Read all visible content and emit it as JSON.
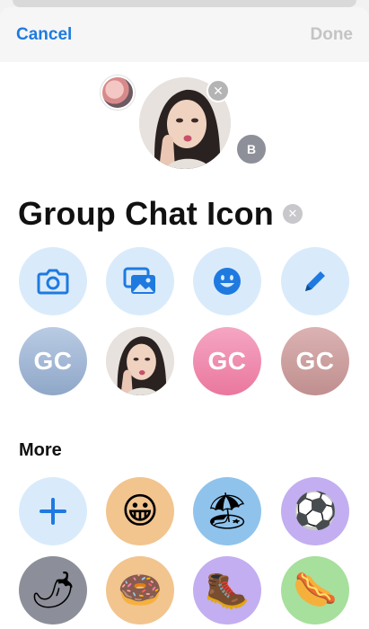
{
  "nav": {
    "cancel_label": "Cancel",
    "done_label": "Done"
  },
  "avatar": {
    "badge_letter": "B"
  },
  "title": "Group Chat Icon",
  "actions": [
    {
      "icon": "camera-icon"
    },
    {
      "icon": "photo-library-icon"
    },
    {
      "icon": "emoji-icon"
    },
    {
      "icon": "pencil-icon"
    }
  ],
  "suggestions": [
    {
      "type": "monogram",
      "text": "GC",
      "color": "#a9bedb"
    },
    {
      "type": "photo"
    },
    {
      "type": "monogram",
      "text": "GC",
      "color": "#ef8fb0"
    },
    {
      "type": "monogram",
      "text": "GC",
      "color": "#cfa3a3"
    }
  ],
  "more": {
    "label": "More",
    "items": [
      {
        "name": "add-icon",
        "glyph": "+",
        "bg": "#d9ebfb"
      },
      {
        "name": "grinning-face-emoji",
        "glyph": "😀",
        "bg": "#f2c48e"
      },
      {
        "name": "beach-umbrella-emoji",
        "glyph": "🏖",
        "bg": "#8fc3ec"
      },
      {
        "name": "soccer-ball-emoji",
        "glyph": "⚽",
        "bg": "#c2aef0"
      },
      {
        "name": "hot-pepper-emoji",
        "glyph": "🌶",
        "bg": "#8c8f99"
      },
      {
        "name": "doughnut-emoji",
        "glyph": "🍩",
        "bg": "#f2c48e"
      },
      {
        "name": "hiking-boot-emoji",
        "glyph": "🥾",
        "bg": "#c2aef0"
      },
      {
        "name": "hot-dog-emoji",
        "glyph": "🌭",
        "bg": "#a7df9d"
      }
    ]
  }
}
